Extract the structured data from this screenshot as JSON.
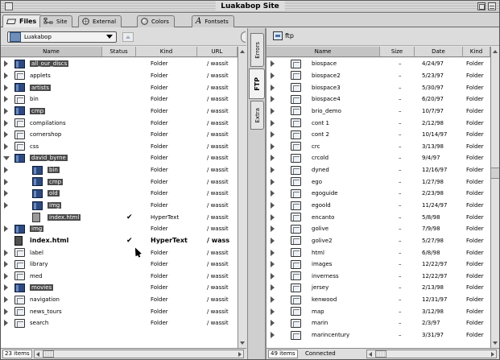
{
  "window": {
    "title": "Luakabop Site"
  },
  "tabs": [
    {
      "label": "Files",
      "active": true,
      "icon": "files-icon"
    },
    {
      "label": "Site",
      "active": false,
      "icon": "site-icon"
    },
    {
      "label": "External",
      "active": false,
      "icon": "external-icon"
    },
    {
      "label": "Colors",
      "active": false,
      "icon": "colors-icon"
    },
    {
      "label": "Fontsets",
      "active": false,
      "icon": "fontsets-icon"
    }
  ],
  "left": {
    "site_select": "Luakabop",
    "columns": {
      "name": "Name",
      "status": "Status",
      "kind": "Kind",
      "url": "URL"
    },
    "rows": [
      {
        "name": "all_our_discs",
        "status": "",
        "kind": "Folder",
        "url": "/ wassit",
        "indent": 0,
        "toggle": "closed",
        "icon": "folder-sel",
        "highlight": true,
        "bold": false
      },
      {
        "name": "applets",
        "status": "",
        "kind": "Folder",
        "url": "/ wassit",
        "indent": 0,
        "toggle": "closed",
        "icon": "folder",
        "highlight": false,
        "bold": false
      },
      {
        "name": "artists",
        "status": "",
        "kind": "Folder",
        "url": "/ wassit",
        "indent": 0,
        "toggle": "closed",
        "icon": "folder-sel",
        "highlight": true,
        "bold": false
      },
      {
        "name": "bin",
        "status": "",
        "kind": "Folder",
        "url": "/ wassit",
        "indent": 0,
        "toggle": "closed",
        "icon": "folder",
        "highlight": false,
        "bold": false
      },
      {
        "name": "cmp",
        "status": "",
        "kind": "Folder",
        "url": "/ wassit",
        "indent": 0,
        "toggle": "closed",
        "icon": "folder-sel",
        "highlight": true,
        "bold": false
      },
      {
        "name": "compilations",
        "status": "",
        "kind": "Folder",
        "url": "/ wassit",
        "indent": 0,
        "toggle": "closed",
        "icon": "folder",
        "highlight": false,
        "bold": false
      },
      {
        "name": "cornershop",
        "status": "",
        "kind": "Folder",
        "url": "/ wassit",
        "indent": 0,
        "toggle": "closed",
        "icon": "folder",
        "highlight": false,
        "bold": false
      },
      {
        "name": "css",
        "status": "",
        "kind": "Folder",
        "url": "/ wassit",
        "indent": 0,
        "toggle": "closed",
        "icon": "folder",
        "highlight": false,
        "bold": false
      },
      {
        "name": "david_byrne",
        "status": "",
        "kind": "Folder",
        "url": "/ wassit",
        "indent": 0,
        "toggle": "open",
        "icon": "folder-sel",
        "highlight": true,
        "bold": false
      },
      {
        "name": "bin",
        "status": "",
        "kind": "Folder",
        "url": "/ wassit",
        "indent": 1,
        "toggle": "closed",
        "icon": "folder-sel",
        "highlight": true,
        "bold": false
      },
      {
        "name": "cmp",
        "status": "",
        "kind": "Folder",
        "url": "/ wassit",
        "indent": 1,
        "toggle": "closed",
        "icon": "folder-sel",
        "highlight": true,
        "bold": false
      },
      {
        "name": "old",
        "status": "",
        "kind": "Folder",
        "url": "/ wassit",
        "indent": 1,
        "toggle": "closed",
        "icon": "folder-sel",
        "highlight": true,
        "bold": false
      },
      {
        "name": "img",
        "status": "",
        "kind": "Folder",
        "url": "/ wassit",
        "indent": 1,
        "toggle": "closed",
        "icon": "folder-sel",
        "highlight": true,
        "bold": false
      },
      {
        "name": "index.html",
        "status": "✔",
        "kind": "HyperText",
        "url": "/ wassit",
        "indent": 1,
        "toggle": "",
        "icon": "doc",
        "highlight": true,
        "bold": false
      },
      {
        "name": "img",
        "status": "",
        "kind": "Folder",
        "url": "/ wassit",
        "indent": 0,
        "toggle": "closed",
        "icon": "folder-sel",
        "highlight": true,
        "bold": false
      },
      {
        "name": "index.html",
        "status": "✔",
        "kind": "HyperText",
        "url": "/ wass",
        "indent": 0,
        "toggle": "",
        "icon": "doc-sel",
        "highlight": true,
        "bold": true
      },
      {
        "name": "label",
        "status": "",
        "kind": "Folder",
        "url": "/ wassit",
        "indent": 0,
        "toggle": "closed",
        "icon": "folder",
        "highlight": false,
        "bold": false
      },
      {
        "name": "library",
        "status": "",
        "kind": "Folder",
        "url": "/ wassit",
        "indent": 0,
        "toggle": "closed",
        "icon": "folder",
        "highlight": false,
        "bold": false
      },
      {
        "name": "med",
        "status": "",
        "kind": "Folder",
        "url": "/ wassit",
        "indent": 0,
        "toggle": "closed",
        "icon": "folder",
        "highlight": false,
        "bold": false
      },
      {
        "name": "movies",
        "status": "",
        "kind": "Folder",
        "url": "/ wassit",
        "indent": 0,
        "toggle": "closed",
        "icon": "folder-sel",
        "highlight": true,
        "bold": false
      },
      {
        "name": "navigation",
        "status": "",
        "kind": "Folder",
        "url": "/ wassit",
        "indent": 0,
        "toggle": "closed",
        "icon": "folder",
        "highlight": false,
        "bold": false
      },
      {
        "name": "news_tours",
        "status": "",
        "kind": "Folder",
        "url": "/ wassit",
        "indent": 0,
        "toggle": "closed",
        "icon": "folder",
        "highlight": false,
        "bold": false
      },
      {
        "name": "search",
        "status": "",
        "kind": "Folder",
        "url": "/ wassit",
        "indent": 0,
        "toggle": "closed",
        "icon": "folder",
        "highlight": false,
        "bold": false
      }
    ],
    "status": {
      "count": "23 items"
    }
  },
  "vertical_tabs": [
    {
      "label": "Errors",
      "active": false
    },
    {
      "label": "FTP",
      "active": true
    },
    {
      "label": "Extra",
      "active": false
    }
  ],
  "right": {
    "header": "ftp",
    "columns": {
      "name": "Name",
      "size": "Size",
      "date": "Date",
      "kind": "Kind"
    },
    "rows": [
      {
        "name": "biospace",
        "size": "–",
        "date": "4/24/97",
        "kind": "Folder"
      },
      {
        "name": "biospace2",
        "size": "–",
        "date": "5/23/97",
        "kind": "Folder"
      },
      {
        "name": "biospace3",
        "size": "–",
        "date": "5/30/97",
        "kind": "Folder"
      },
      {
        "name": "biospace4",
        "size": "–",
        "date": "6/20/97",
        "kind": "Folder"
      },
      {
        "name": "brio_demo",
        "size": "–",
        "date": "10/7/97",
        "kind": "Folder"
      },
      {
        "name": "cont 1",
        "size": "–",
        "date": "2/12/98",
        "kind": "Folder"
      },
      {
        "name": "cont 2",
        "size": "–",
        "date": "10/14/97",
        "kind": "Folder"
      },
      {
        "name": "crc",
        "size": "–",
        "date": "3/13/98",
        "kind": "Folder"
      },
      {
        "name": "crcold",
        "size": "–",
        "date": "9/4/97",
        "kind": "Folder"
      },
      {
        "name": "dyned",
        "size": "–",
        "date": "12/16/97",
        "kind": "Folder"
      },
      {
        "name": "ego",
        "size": "–",
        "date": "1/27/98",
        "kind": "Folder"
      },
      {
        "name": "egoguide",
        "size": "–",
        "date": "2/23/98",
        "kind": "Folder"
      },
      {
        "name": "egoold",
        "size": "–",
        "date": "11/24/97",
        "kind": "Folder"
      },
      {
        "name": "encanto",
        "size": "–",
        "date": "5/8/98",
        "kind": "Folder"
      },
      {
        "name": "golive",
        "size": "–",
        "date": "7/9/98",
        "kind": "Folder"
      },
      {
        "name": "golive2",
        "size": "–",
        "date": "5/27/98",
        "kind": "Folder"
      },
      {
        "name": "html",
        "size": "–",
        "date": "6/8/98",
        "kind": "Folder"
      },
      {
        "name": "images",
        "size": "–",
        "date": "12/22/97",
        "kind": "Folder"
      },
      {
        "name": "inverness",
        "size": "–",
        "date": "12/22/97",
        "kind": "Folder"
      },
      {
        "name": "jersey",
        "size": "–",
        "date": "2/13/98",
        "kind": "Folder"
      },
      {
        "name": "kenwood",
        "size": "–",
        "date": "12/31/97",
        "kind": "Folder"
      },
      {
        "name": "map",
        "size": "–",
        "date": "3/12/98",
        "kind": "Folder"
      },
      {
        "name": "marin",
        "size": "–",
        "date": "2/3/97",
        "kind": "Folder"
      },
      {
        "name": "marincentury",
        "size": "–",
        "date": "3/31/97",
        "kind": "Folder"
      }
    ],
    "status": {
      "count": "49 items",
      "connection": "Connected"
    }
  }
}
